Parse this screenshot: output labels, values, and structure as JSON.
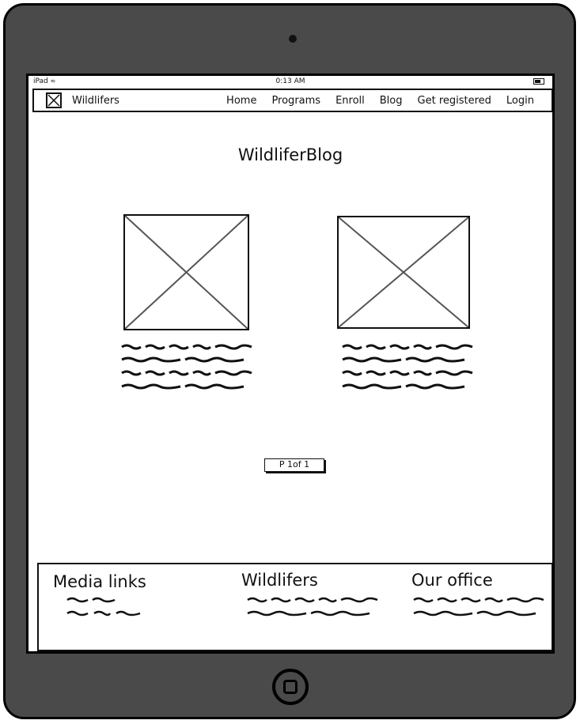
{
  "statusbar": {
    "device": "iPad",
    "time": "0:13 AM"
  },
  "navbar": {
    "brand": "Wildlifers",
    "items": [
      {
        "label": "Home"
      },
      {
        "label": "Programs"
      },
      {
        "label": "Enroll"
      },
      {
        "label": "Blog"
      },
      {
        "label": "Get registered"
      },
      {
        "label": "Login"
      }
    ]
  },
  "page": {
    "title": "WildliferBlog"
  },
  "pagination": {
    "label": "P 1of 1"
  },
  "footer": {
    "columns": [
      {
        "heading": "Media links"
      },
      {
        "heading": "Wildlifers"
      },
      {
        "heading": "Our office"
      }
    ]
  },
  "icons": [
    "wifi-icon",
    "battery-icon",
    "logo-placeholder-icon",
    "image-placeholder-icon",
    "home-button-icon"
  ],
  "colors": {
    "frame": "#4a4a4a",
    "stroke": "#111111",
    "screen": "#ffffff"
  }
}
